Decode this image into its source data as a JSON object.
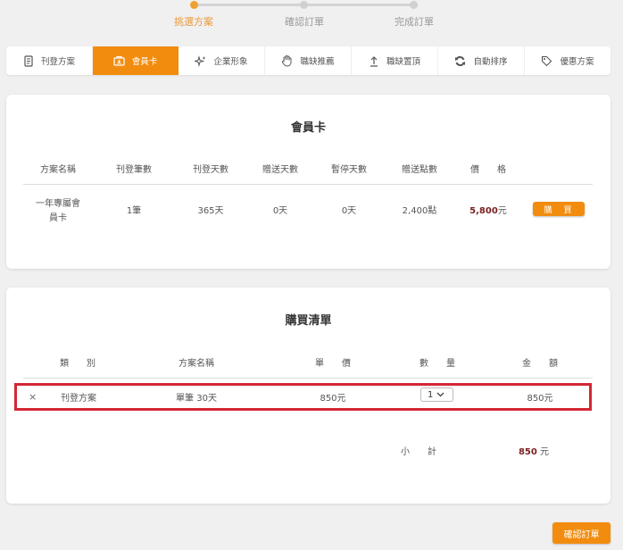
{
  "stepper": {
    "steps": [
      {
        "label": "挑選方案",
        "active": true
      },
      {
        "label": "確認訂單",
        "active": false
      },
      {
        "label": "完成訂單",
        "active": false
      }
    ]
  },
  "tabs": [
    {
      "label": "刊登方案",
      "icon": "document-icon",
      "active": false
    },
    {
      "label": "會員卡",
      "icon": "id-card-icon",
      "active": true
    },
    {
      "label": "企業形象",
      "icon": "sparkle-icon",
      "active": false
    },
    {
      "label": "職缺推薦",
      "icon": "hand-icon",
      "active": false
    },
    {
      "label": "職缺置頂",
      "icon": "arrow-up-icon",
      "active": false
    },
    {
      "label": "自動排序",
      "icon": "refresh-icon",
      "active": false
    },
    {
      "label": "優惠方案",
      "icon": "tag-icon",
      "active": false
    }
  ],
  "member_card": {
    "title": "會員卡",
    "headers": [
      "方案名稱",
      "刊登筆數",
      "刊登天數",
      "贈送天數",
      "暫停天數",
      "贈送點數",
      "價　　格"
    ],
    "row": {
      "name_line1": "一年專屬會",
      "name_line2": "員卡",
      "posts": "1筆",
      "days": "365天",
      "bonus_days": "0天",
      "pause_days": "0天",
      "bonus_points": "2,400點",
      "price": "5,800",
      "price_unit": "元"
    },
    "buy_label": "購　買"
  },
  "cart": {
    "title": "購買清單",
    "headers": [
      "類　　別",
      "方案名稱",
      "單　　價",
      "數　　量",
      "金　　額"
    ],
    "row": {
      "remove": "×",
      "category": "刊登方案",
      "plan": "單筆 30天",
      "unit_price": "850元",
      "quantity": "1",
      "amount": "850元"
    },
    "subtotal_label": "小　　計",
    "subtotal_value": "850",
    "subtotal_unit": "元"
  },
  "confirm_label": "確認訂單",
  "colors": {
    "accent": "#f28c0f",
    "step_active": "#f0a030",
    "price": "#7a1f1f",
    "highlight": "#d32733"
  }
}
